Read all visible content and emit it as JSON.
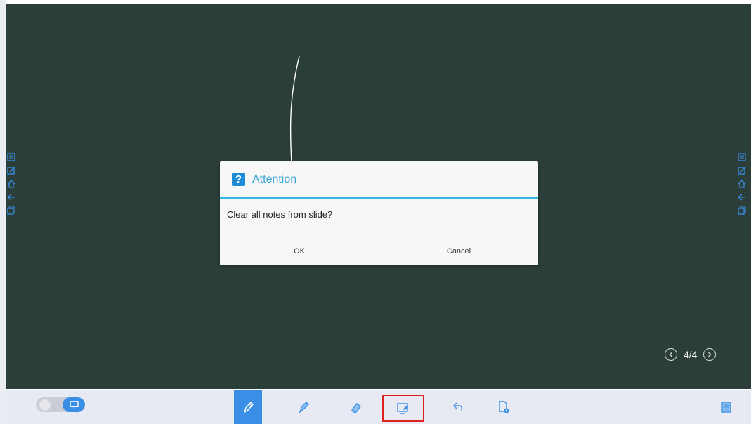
{
  "dialog": {
    "title": "Attention",
    "question_glyph": "?",
    "message": "Clear all notes from slide?",
    "ok_label": "OK",
    "cancel_label": "Cancel"
  },
  "pager": {
    "page": "4/4"
  },
  "side_icons": [
    "note-icon",
    "edit-icon",
    "home-icon",
    "back-icon",
    "window-icon"
  ],
  "toolbar_tools": [
    "pen-icon",
    "brush-icon",
    "eraser-icon",
    "screen-annotate-icon",
    "undo-icon",
    "add-page-icon",
    "pages-icon"
  ],
  "colors": {
    "board": "#2b3e3a",
    "accent": "#3a8ee6",
    "dialog_title": "#3aa8dc",
    "highlight_box": "#e02020"
  }
}
